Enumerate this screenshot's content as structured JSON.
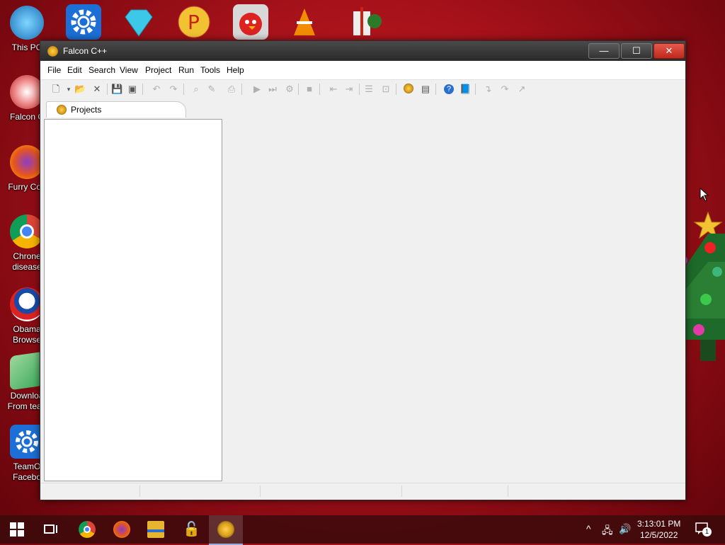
{
  "desktop": {
    "icons": [
      {
        "label": "This PC",
        "icon": "this-pc-icon"
      },
      {
        "label": "Falcon C",
        "icon": "falcon-cpp-icon"
      },
      {
        "label": "Furry Coo",
        "icon": "firefox-icon"
      },
      {
        "label": "Chrone",
        "label2": "disease",
        "icon": "chrome-icon"
      },
      {
        "label": "Obama",
        "label2": "Browse",
        "icon": "obama-browser-icon"
      },
      {
        "label": "Downloa",
        "label2": "From tean",
        "icon": "download-icon"
      },
      {
        "label": "TeamO",
        "label2": "Facebo",
        "icon": "gear-icon"
      }
    ]
  },
  "window": {
    "title": "Falcon C++",
    "controls": {
      "minimize": "—",
      "maximize": "☐",
      "close": "✕"
    },
    "menu": [
      "File",
      "Edit",
      "Search",
      "View",
      "Project",
      "Run",
      "Tools",
      "Help"
    ],
    "tabs": [
      {
        "label": "Projects",
        "icon": "falcon-icon"
      }
    ]
  },
  "taskbar": {
    "clock_time": "3:13:01 PM",
    "clock_date": "12/5/2022",
    "notification_count": "1"
  },
  "colors": {
    "desktop_bg": "#a8121a",
    "titlebar": "#2f2f2f",
    "close": "#d13a2c"
  }
}
